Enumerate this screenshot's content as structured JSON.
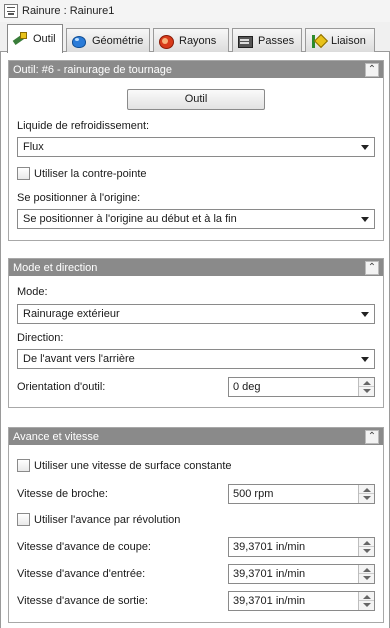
{
  "window": {
    "title": "Rainure : Rainure1"
  },
  "tabs": [
    {
      "label": "Outil",
      "icon": "tool-icon",
      "active": true
    },
    {
      "label": "Géométrie",
      "icon": "geometry-icon",
      "active": false
    },
    {
      "label": "Rayons",
      "icon": "radius-icon",
      "active": false
    },
    {
      "label": "Passes",
      "icon": "passes-icon",
      "active": false
    },
    {
      "label": "Liaison",
      "icon": "link-icon",
      "active": false
    }
  ],
  "outil": {
    "header": "Outil: #6 - rainurage de tournage",
    "tool_button": "Outil",
    "coolant_label": "Liquide de refroidissement:",
    "coolant_value": "Flux",
    "tailstock_label": "Utiliser la contre-pointe",
    "tailstock_checked": false,
    "origin_label": "Se positionner à l'origine:",
    "origin_value": "Se positionner à l'origine au début et à la fin"
  },
  "mode": {
    "header": "Mode et direction",
    "mode_label": "Mode:",
    "mode_value": "Rainurage extérieur",
    "direction_label": "Direction:",
    "direction_value": "De l'avant vers l'arrière",
    "orientation_label": "Orientation d'outil:",
    "orientation_value": "0 deg"
  },
  "feed": {
    "header": "Avance et vitesse",
    "css_label": "Utiliser une vitesse de surface constante",
    "css_checked": false,
    "spindle_label": "Vitesse de broche:",
    "spindle_value": "500 rpm",
    "per_rev_label": "Utiliser l'avance par révolution",
    "per_rev_checked": false,
    "cut_label": "Vitesse d'avance de coupe:",
    "cut_value": "39,3701 in/min",
    "lead_in_label": "Vitesse d'avance d'entrée:",
    "lead_in_value": "39,3701 in/min",
    "lead_out_label": "Vitesse d'avance de sortie:",
    "lead_out_value": "39,3701 in/min"
  }
}
